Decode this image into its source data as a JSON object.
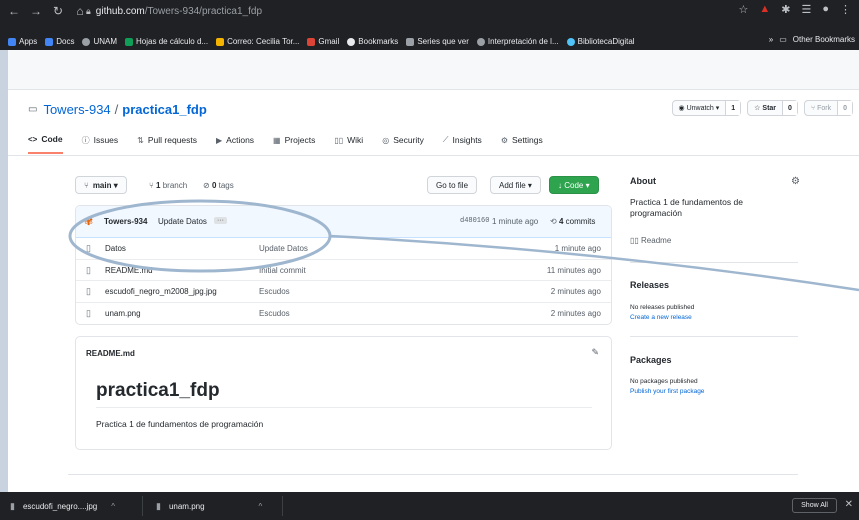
{
  "browser": {
    "url_host": "github.com",
    "url_path": "/Towers-934/practica1_fdp",
    "bookmarks": [
      {
        "label": "Apps",
        "color": "#4285f4"
      },
      {
        "label": "Docs",
        "color": "#4285f4"
      },
      {
        "label": "UNAM",
        "color": "#9aa0a6"
      },
      {
        "label": "Hojas de cálculo d...",
        "color": "#0f9d58"
      },
      {
        "label": "Correo: Cecilia Tor...",
        "color": "#f4b400"
      },
      {
        "label": "Gmail",
        "color": "#db4437"
      },
      {
        "label": "Bookmarks",
        "color": "#e8eaed"
      },
      {
        "label": "Series que ver",
        "color": "#9aa0a6"
      },
      {
        "label": "Interpretación de l...",
        "color": "#9aa0a6"
      },
      {
        "label": "BibliotecaDigital",
        "color": "#4fc3f7"
      }
    ],
    "other_bookmarks": "Other Bookmarks",
    "more": "»"
  },
  "repo": {
    "owner": "Towers-934",
    "separator": "/",
    "name": "practica1_fdp",
    "watch_label": "Unwatch ▾",
    "watch_count": "1",
    "star_label": "Star",
    "star_count": "0",
    "fork_label": "Fork",
    "fork_count": "0"
  },
  "tabs": [
    {
      "icon": "<>",
      "label": "Code"
    },
    {
      "icon": "ⓘ",
      "label": "Issues"
    },
    {
      "icon": "⇅",
      "label": "Pull requests"
    },
    {
      "icon": "▶",
      "label": "Actions"
    },
    {
      "icon": "▦",
      "label": "Projects"
    },
    {
      "icon": "▯▯",
      "label": "Wiki"
    },
    {
      "icon": "◎",
      "label": "Security"
    },
    {
      "icon": "⟋",
      "label": "Insights"
    },
    {
      "icon": "⚙",
      "label": "Settings"
    }
  ],
  "branchbar": {
    "branch_label": "main ▾",
    "branches_count": "1",
    "branches_text": " branch",
    "tags_count": "0",
    "tags_text": " tags",
    "goto_file": "Go to file",
    "add_file": "Add file ▾",
    "code_btn": "↓ Code ▾"
  },
  "commit": {
    "author": "Towers-934",
    "message": "Update Datos",
    "dots": "···",
    "sha": "d480160",
    "time": "1 minute ago",
    "count": "4",
    "count_text": " commits"
  },
  "files": [
    {
      "name": "Datos",
      "commit": "Update Datos",
      "time": "1 minute ago"
    },
    {
      "name": "README.md",
      "commit": "Initial commit",
      "time": "11 minutes ago"
    },
    {
      "name": "escudofi_negro_m2008_jpg.jpg",
      "commit": "Escudos",
      "time": "2 minutes ago"
    },
    {
      "name": "unam.png",
      "commit": "Escudos",
      "time": "2 minutes ago"
    }
  ],
  "readme": {
    "header": "README.md",
    "title": "practica1_fdp",
    "text": "Practica 1 de fundamentos de programación"
  },
  "sidebar": {
    "about_title": "About",
    "description": "Practica 1 de fundamentos de programación",
    "readme_link": "Readme",
    "releases_title": "Releases",
    "releases_none": "No releases published",
    "releases_create": "Create a new release",
    "packages_title": "Packages",
    "packages_none": "No packages published",
    "packages_publish": "Publish your first package"
  },
  "downloads": {
    "item1": "escudofi_negro....jpg",
    "item2": "unam.png",
    "show_all": "Show All"
  },
  "colors": {
    "accent": "#0366d6",
    "green": "#2ea44f",
    "tab_underline": "#f9826c",
    "annotation": "#9fb6cf"
  }
}
